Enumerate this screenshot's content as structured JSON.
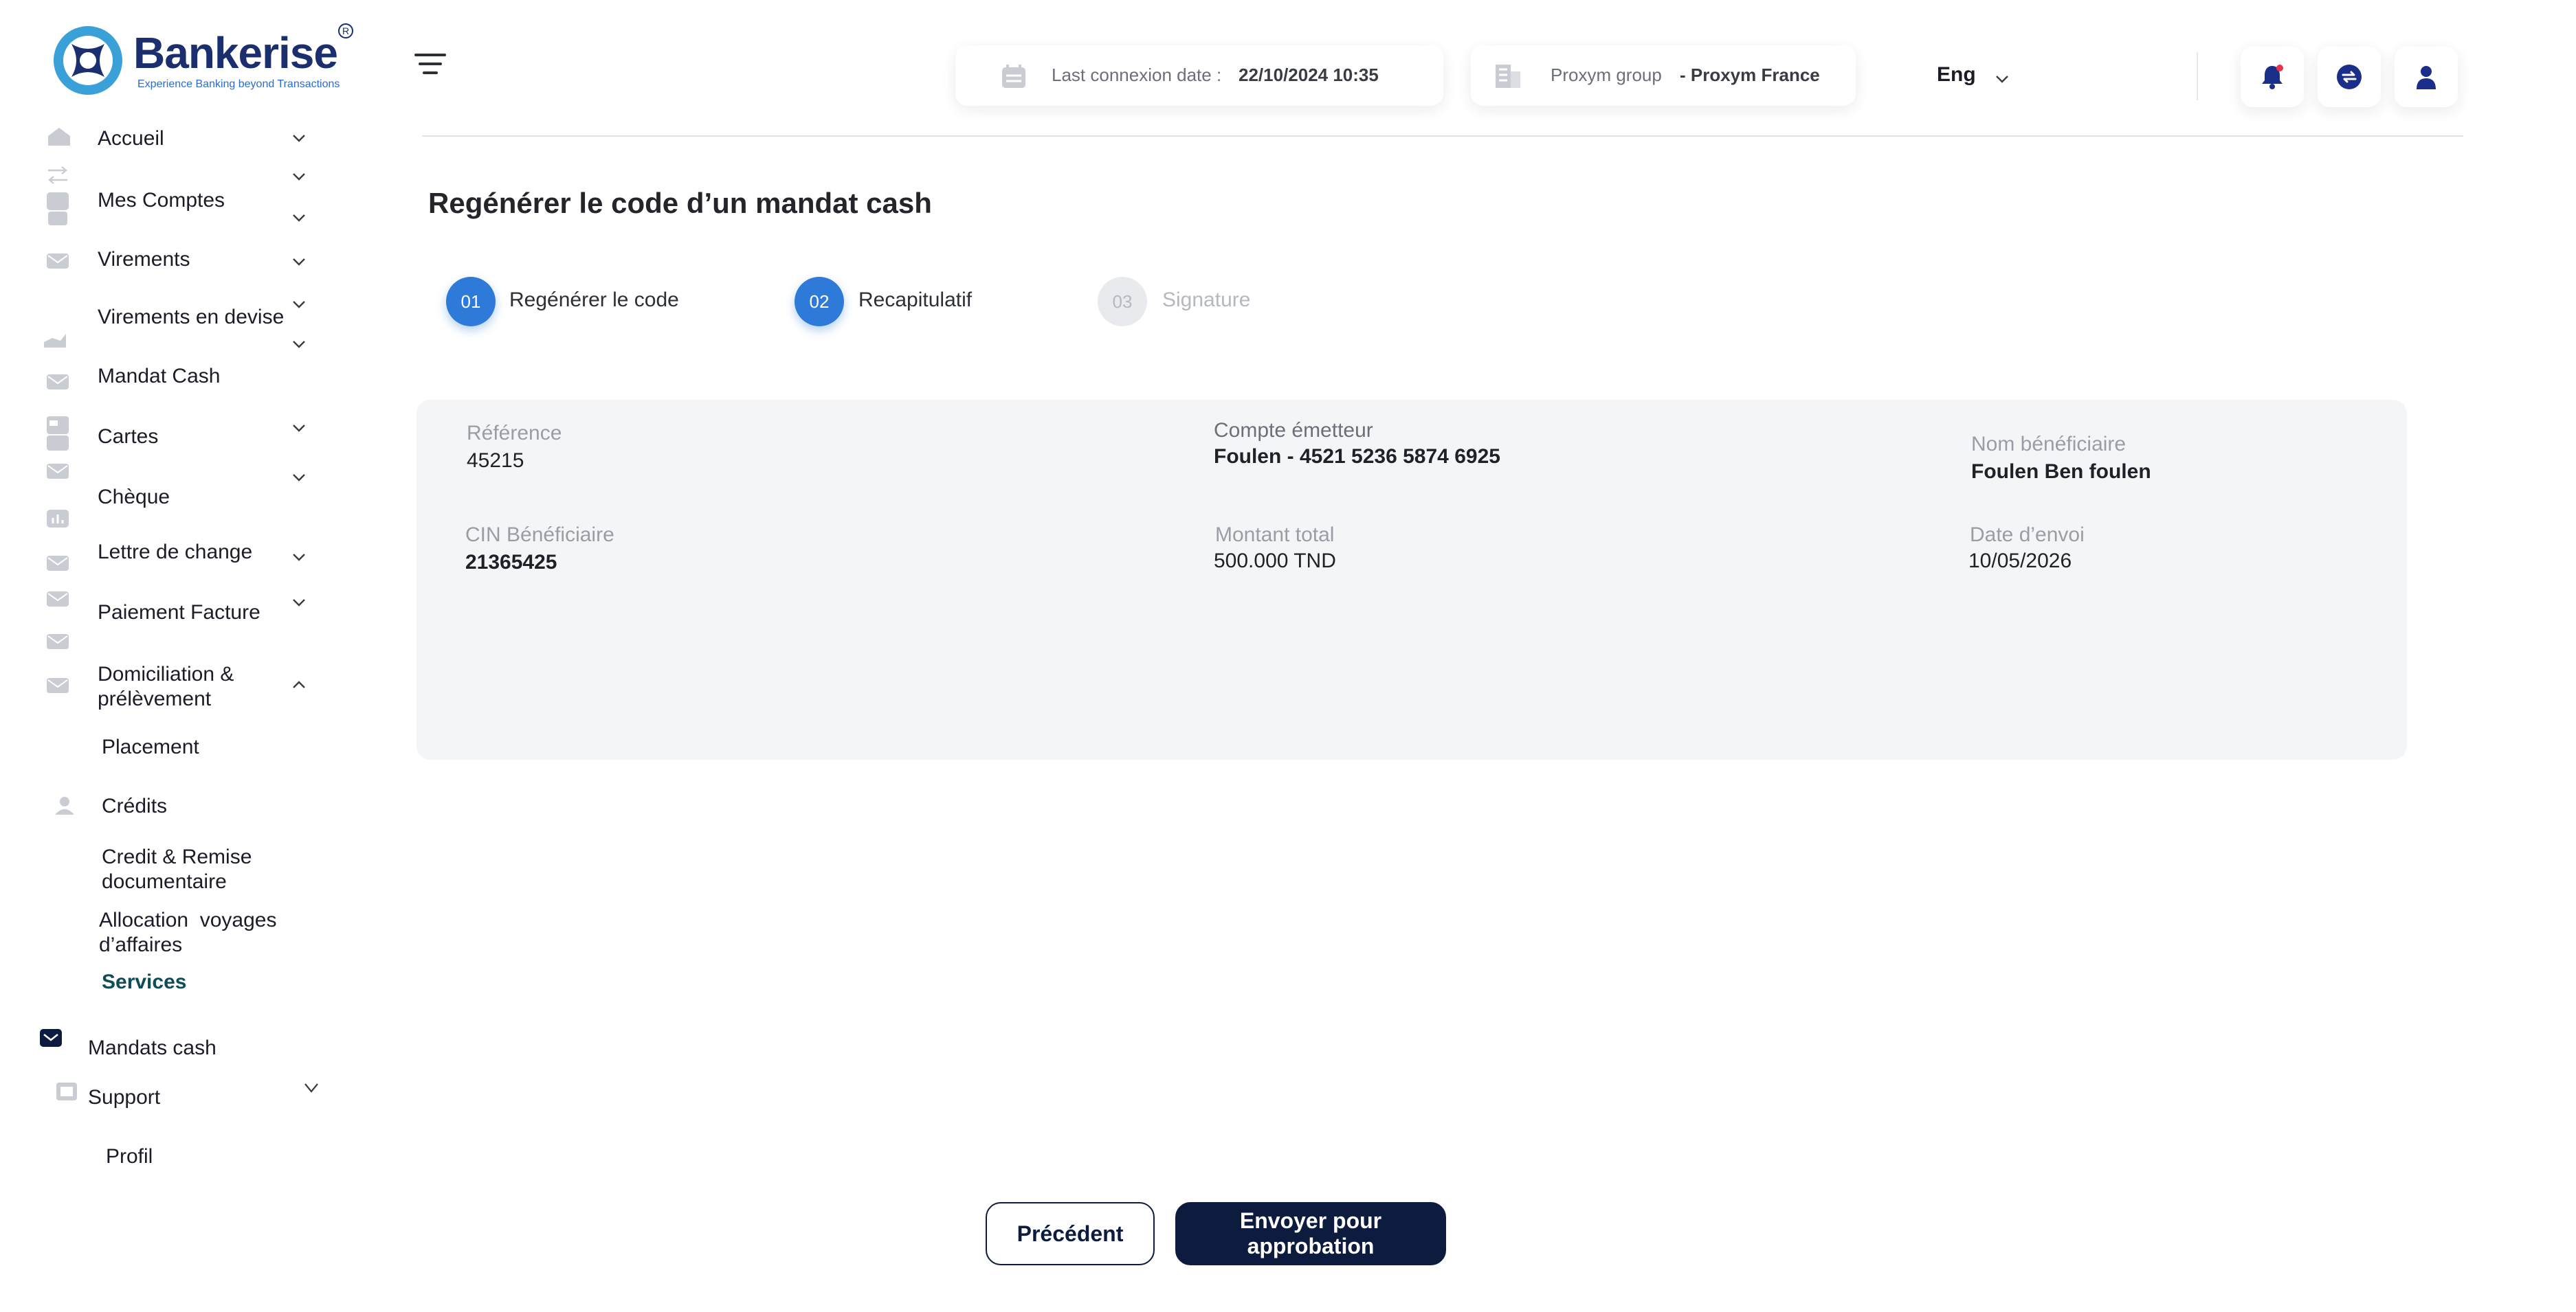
{
  "brand": {
    "name": "Bankerise",
    "registered": "R",
    "tagline": "Experience Banking beyond Transactions",
    "primary_color": "#0d1b3e",
    "accent_color": "#2e7ad8"
  },
  "sidebar": {
    "items": [
      {
        "label": "Accueil",
        "icon": "home-icon"
      },
      {
        "label": "Mes Comptes",
        "icon": "wallet-icon"
      },
      {
        "label": "Virements",
        "icon": "envelope-icon"
      },
      {
        "label": "Virements en devise",
        "icon": "transfer-icon"
      },
      {
        "label": "Mandat Cash",
        "icon": "envelope-icon"
      },
      {
        "label": "Cartes",
        "icon": "card-icon"
      },
      {
        "label": "Chèque",
        "icon": "envelope-icon"
      },
      {
        "label": "Lettre de change",
        "icon": "envelope-icon"
      },
      {
        "label": "Paiement Facture",
        "icon": "envelope-icon"
      },
      {
        "label": "Domiciliation & prélèvement",
        "icon": "envelope-icon"
      },
      {
        "label": "Placement",
        "icon": ""
      },
      {
        "label": "Crédits",
        "icon": "user-icon"
      },
      {
        "label": "Credit & Remise documentaire",
        "icon": ""
      },
      {
        "label": "Allocation  voyages d’affaires",
        "icon": ""
      },
      {
        "label": "Services",
        "icon": ""
      },
      {
        "label": "Mandats cash",
        "icon": "envelope-icon"
      },
      {
        "label": "Support",
        "icon": "support-icon"
      },
      {
        "label": "Profil",
        "icon": ""
      }
    ]
  },
  "header": {
    "last_connexion_label": "Last connexion date :",
    "last_connexion_value": "22/10/2024 10:35",
    "group_label": "Proxym group",
    "group_value": "- Proxym France",
    "language": "Eng"
  },
  "page": {
    "title": "Regénérer le code d’un mandat cash"
  },
  "steps": [
    {
      "number": "01",
      "label": "Regénérer le code",
      "state": "done"
    },
    {
      "number": "02",
      "label": "Recapitulatif",
      "state": "active"
    },
    {
      "number": "03",
      "label": "Signature",
      "state": "pending"
    }
  ],
  "recap": {
    "reference_label": "Référence",
    "reference_value": "45215",
    "compte_label": "Compte émetteur",
    "compte_value": "Foulen - 4521 5236 5874 6925",
    "beneficiaire_label": "Nom bénéficiaire",
    "beneficiaire_value": "Foulen Ben foulen",
    "cin_label": "CIN Bénéficiaire",
    "cin_value": "21365425",
    "montant_label": "Montant total",
    "montant_value": "500.000 TND",
    "date_label": "Date d’envoi",
    "date_value": "10/05/2026"
  },
  "actions": {
    "previous_label": "Précédent",
    "submit_label": "Envoyer pour approbation"
  }
}
